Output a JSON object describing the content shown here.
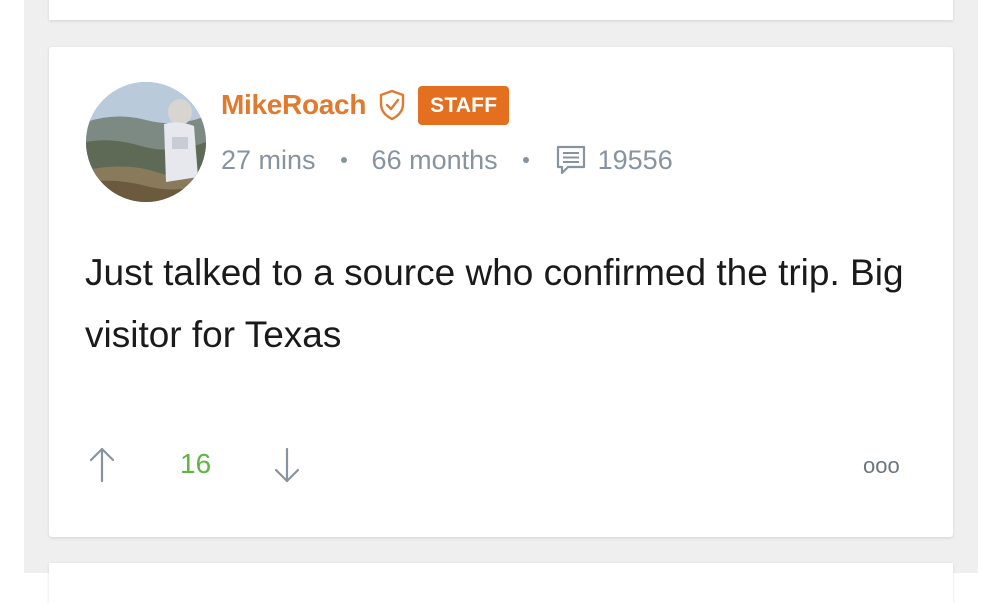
{
  "post": {
    "author": "MikeRoach",
    "badge": "STAFF",
    "time_ago": "27 mins",
    "member_age": "66 months",
    "post_count": "19556",
    "text": "Just talked to a source who confirmed the trip. Big visitor for Texas",
    "votes": "16",
    "more_label": "ooo",
    "icons": {
      "verified": "shield-check-icon",
      "posts": "message-icon",
      "upvote": "arrow-up-icon",
      "downvote": "arrow-down-icon"
    }
  },
  "colors": {
    "author": "#e07a2e",
    "badge_bg": "#e46f1f",
    "meta": "#8893a0",
    "votes": "#5db544",
    "text": "#1a1a1a"
  }
}
